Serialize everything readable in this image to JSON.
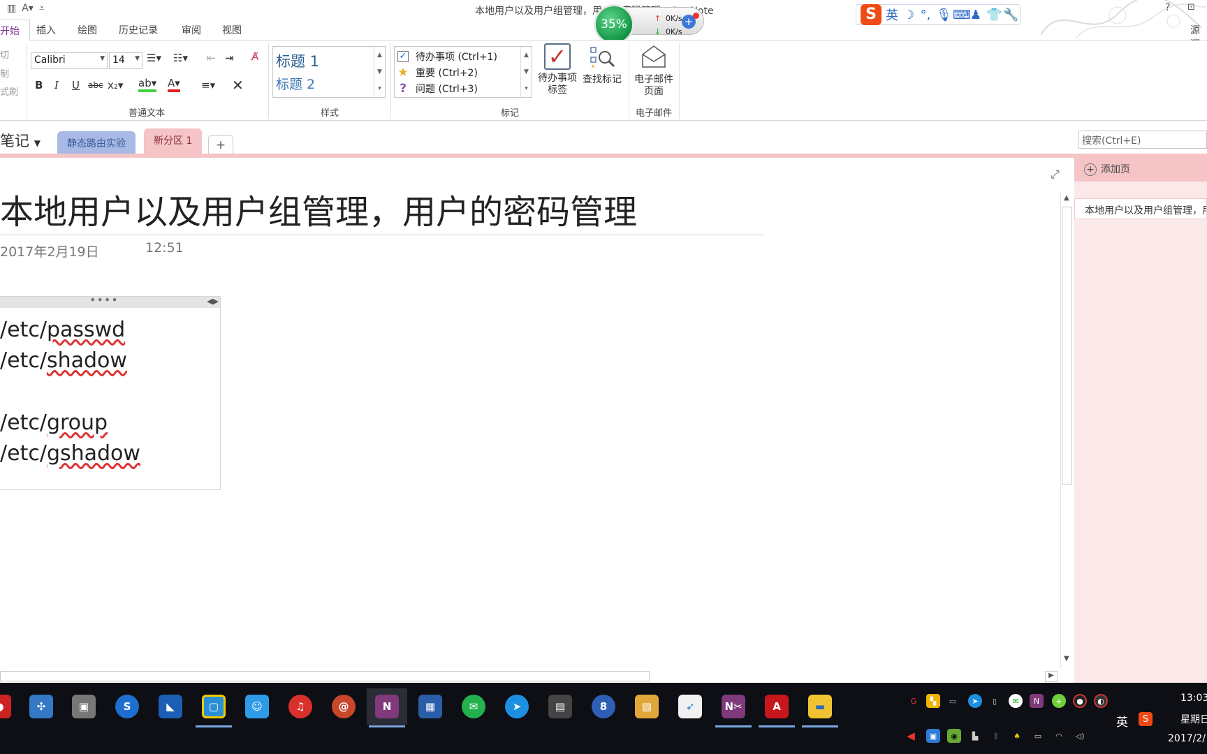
{
  "window": {
    "title": "本地用户以及用户组管理，用户的密码管理 - OneNote"
  },
  "net_widget": {
    "percent": "35%",
    "up_speed": "0K/s",
    "down_speed": "0K/s"
  },
  "ime": {
    "mode": "英"
  },
  "ribbon_tabs": [
    {
      "label": "开始"
    },
    {
      "label": "插入"
    },
    {
      "label": "绘图"
    },
    {
      "label": "历史记录"
    },
    {
      "label": "审阅"
    },
    {
      "label": "视图"
    }
  ],
  "account": "源源",
  "clipboard": {
    "cut": "切",
    "copy": "制",
    "format_painter": "式刷"
  },
  "basic_text": {
    "font_name": "Calibri",
    "font_size": "14",
    "group_label": "普通文本"
  },
  "styles": {
    "heading1": "标题 1",
    "heading2": "标题 2",
    "group_label": "样式"
  },
  "tags": {
    "items": [
      {
        "label": "待办事项 (Ctrl+1)",
        "icon": "checkbox-icon"
      },
      {
        "label": "重要 (Ctrl+2)",
        "icon": "star-icon"
      },
      {
        "label": "问题 (Ctrl+3)",
        "icon": "question-icon"
      }
    ],
    "todo_tag_button": "待办事项\n标签",
    "find_tags_button": "查找标记",
    "group_label": "标记"
  },
  "email": {
    "button": "电子邮件\n页面",
    "group_label": "电子邮件"
  },
  "notebook": {
    "name": "笔记",
    "sections": [
      {
        "label": "静态路由实验",
        "color": "#a7b9e4"
      },
      {
        "label": "新分区 1",
        "color": "#f4c4c6"
      }
    ],
    "add_section": "+",
    "search_placeholder": "搜索(Ctrl+E)"
  },
  "page": {
    "title": "本地用户以及用户组管理，用户的密码管理",
    "date": "2017年2月19日",
    "time": "12:51",
    "lines": [
      "/etc/passwd",
      "/etc/shadow",
      "",
      "/etc/group",
      "/etc/gshadow"
    ]
  },
  "page_pane": {
    "add_page": "添加页",
    "pages": [
      {
        "title": "本地用户以及用户组管理，用户的密码管理"
      }
    ]
  },
  "taskbar": {
    "ime_indicator": "英",
    "time": "13:03",
    "weekday": "星期日",
    "date": "2017/2/"
  }
}
